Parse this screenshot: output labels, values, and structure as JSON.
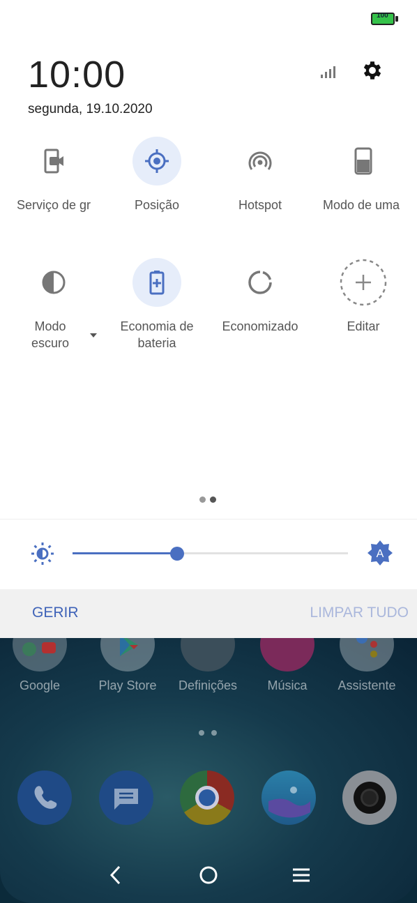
{
  "status": {
    "battery": "100",
    "battery_color": "#35c24a"
  },
  "header": {
    "time": "10:00",
    "date": "segunda, 19.10.2020"
  },
  "tiles": [
    {
      "label": "Serviço de gr",
      "icon": "screen-record-icon",
      "active": false
    },
    {
      "label": "Posição",
      "icon": "location-icon",
      "active": true
    },
    {
      "label": "Hotspot",
      "icon": "hotspot-icon",
      "active": false
    },
    {
      "label": "Modo de uma",
      "icon": "one-hand-mode-icon",
      "active": false
    },
    {
      "label_line1": "Modo",
      "label_line2": "escuro",
      "icon": "dark-mode-icon",
      "active": false
    },
    {
      "label_line1": "Economia de",
      "label_line2": "bateria",
      "icon": "battery-saver-icon",
      "active": true
    },
    {
      "label": "Economizado",
      "icon": "data-saver-icon",
      "active": false
    },
    {
      "label": "Editar",
      "icon": "edit-add-icon",
      "active": false
    }
  ],
  "brightness": {
    "level": 0.38,
    "accent": "#4a6fc1"
  },
  "notifications_bar": {
    "manage": "GERIR",
    "clear_all": "LIMPAR TUDO"
  },
  "home": {
    "apps": [
      {
        "name": "Google",
        "icon": "google-folder-icon"
      },
      {
        "name": "Play Store",
        "icon": "play-store-icon"
      },
      {
        "name": "Definições",
        "icon": "settings-app-icon"
      },
      {
        "name": "Música",
        "icon": "music-icon"
      },
      {
        "name": "Assistente",
        "icon": "assistant-icon"
      }
    ],
    "dock": [
      {
        "icon": "phone-icon"
      },
      {
        "icon": "messages-icon"
      },
      {
        "icon": "chrome-icon"
      },
      {
        "icon": "gallery-icon"
      },
      {
        "icon": "camera-icon"
      }
    ]
  },
  "navigation": {
    "back": "back-icon",
    "home": "home-icon",
    "recents": "recents-icon"
  }
}
